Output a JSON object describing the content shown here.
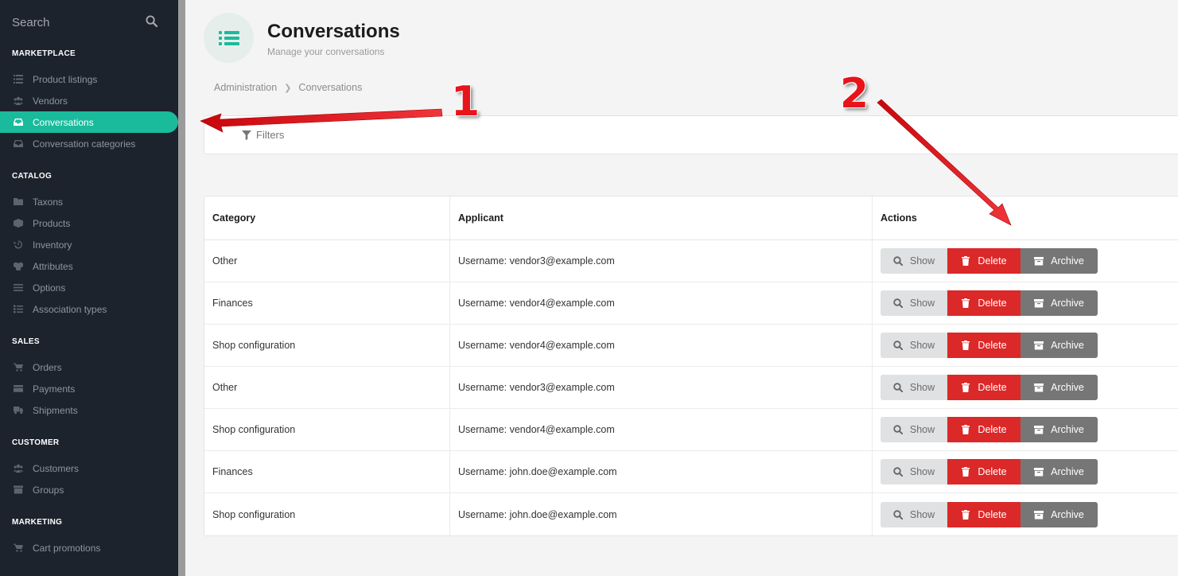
{
  "sidebar": {
    "search_placeholder": "Search",
    "sections": [
      {
        "title": "MARKETPLACE",
        "items": [
          {
            "label": "Product listings",
            "icon": "list-icon"
          },
          {
            "label": "Vendors",
            "icon": "users-icon"
          },
          {
            "label": "Conversations",
            "icon": "inbox-icon",
            "active": true
          },
          {
            "label": "Conversation categories",
            "icon": "inbox-icon"
          }
        ]
      },
      {
        "title": "CATALOG",
        "items": [
          {
            "label": "Taxons",
            "icon": "folder-icon"
          },
          {
            "label": "Products",
            "icon": "cube-icon"
          },
          {
            "label": "Inventory",
            "icon": "history-icon"
          },
          {
            "label": "Attributes",
            "icon": "cubes-icon"
          },
          {
            "label": "Options",
            "icon": "sliders-icon"
          },
          {
            "label": "Association types",
            "icon": "tasks-icon"
          }
        ]
      },
      {
        "title": "SALES",
        "items": [
          {
            "label": "Orders",
            "icon": "cart-icon"
          },
          {
            "label": "Payments",
            "icon": "credit-card-icon"
          },
          {
            "label": "Shipments",
            "icon": "truck-icon"
          }
        ]
      },
      {
        "title": "CUSTOMER",
        "items": [
          {
            "label": "Customers",
            "icon": "users-icon"
          },
          {
            "label": "Groups",
            "icon": "archive-icon"
          }
        ]
      },
      {
        "title": "MARKETING",
        "items": [
          {
            "label": "Cart promotions",
            "icon": "cart-icon"
          }
        ]
      }
    ]
  },
  "header": {
    "title": "Conversations",
    "subtitle": "Manage your conversations"
  },
  "breadcrumb": {
    "items": [
      "Administration",
      "Conversations"
    ]
  },
  "filters": {
    "label": "Filters"
  },
  "table": {
    "columns": [
      "Category",
      "Applicant",
      "Actions"
    ],
    "rows": [
      {
        "category": "Other",
        "applicant": "Username: vendor3@example.com"
      },
      {
        "category": "Finances",
        "applicant": "Username: vendor4@example.com"
      },
      {
        "category": "Shop configuration",
        "applicant": "Username: vendor4@example.com"
      },
      {
        "category": "Other",
        "applicant": "Username: vendor3@example.com"
      },
      {
        "category": "Shop configuration",
        "applicant": "Username: vendor4@example.com"
      },
      {
        "category": "Finances",
        "applicant": "Username: john.doe@example.com"
      },
      {
        "category": "Shop configuration",
        "applicant": "Username: john.doe@example.com"
      }
    ],
    "actions": {
      "show": "Show",
      "delete": "Delete",
      "archive": "Archive"
    }
  },
  "annotations": {
    "marker_1": "1",
    "marker_2": "2"
  },
  "colors": {
    "sidebar_bg": "#1d232d",
    "active": "#1abb9c",
    "delete": "#db2828",
    "archive": "#767676",
    "annotation": "#e8141b"
  }
}
